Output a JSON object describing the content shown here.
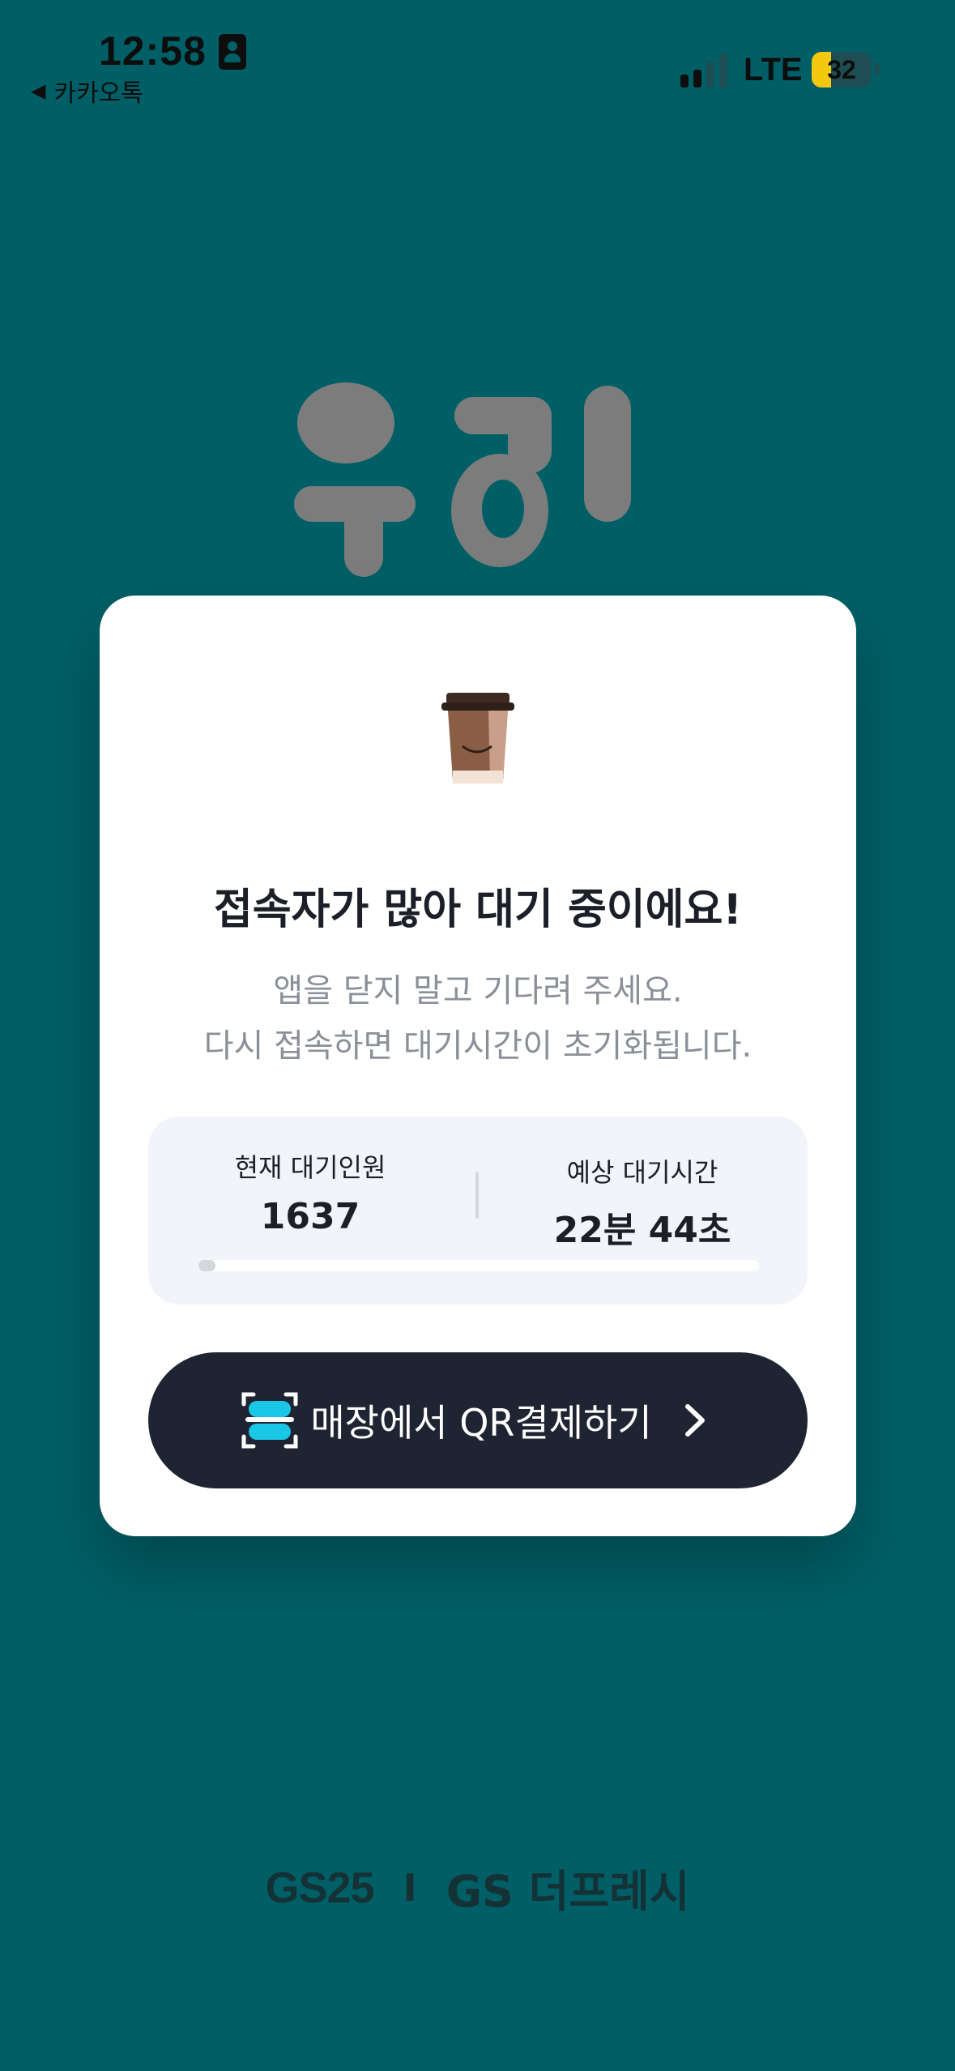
{
  "status_bar": {
    "time": "12:58",
    "back_label": "카카오톡",
    "network": "LTE",
    "battery": "32",
    "battery_level": 0.32
  },
  "card": {
    "title": "접속자가 많아 대기 중이에요!",
    "subtitle_line1": "앱을 닫지 말고 기다려 주세요.",
    "subtitle_line2": "다시 접속하면 대기시간이 초기화됩니다.",
    "stats": {
      "current_waiting_label": "현재 대기인원",
      "current_waiting_value": "1637",
      "expected_time_label": "예상 대기시간",
      "expected_time_value": "22분 44초",
      "progress_fraction": 0.03
    },
    "qr_button_label": "매장에서 QR결제하기"
  },
  "footer": {
    "brand1": "GS25",
    "separator": "I",
    "brand2": "GS 더프레시"
  },
  "colors": {
    "background": "#005f66",
    "card": "#ffffff",
    "button": "#1f2432",
    "qr_accent": "#19c6e6",
    "battery": "#f2c811"
  },
  "icons": [
    "id-card-icon",
    "back-triangle-icon",
    "signal-icon",
    "battery-icon",
    "coffee-cup-icon",
    "qr-scan-icon",
    "chevron-right-icon"
  ]
}
